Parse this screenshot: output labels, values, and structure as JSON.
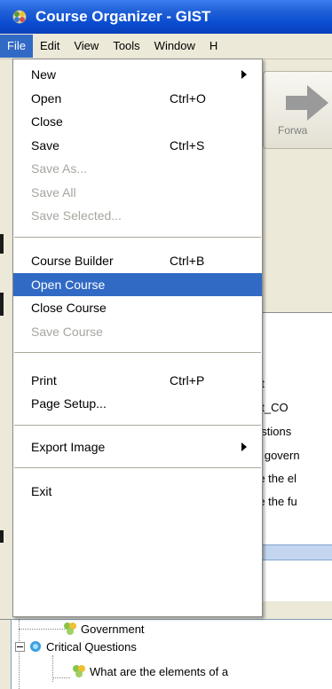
{
  "window": {
    "title": "Course Organizer - GIST",
    "icon": "app-gear-icon"
  },
  "menubar": [
    "File",
    "Edit",
    "View",
    "Tools",
    "Window",
    "H"
  ],
  "file_menu": {
    "new": "New",
    "open": "Open",
    "open_sc": "Ctrl+O",
    "close": "Close",
    "save": "Save",
    "save_sc": "Ctrl+S",
    "save_as": "Save As...",
    "save_all": "Save All",
    "save_selected": "Save Selected...",
    "course_builder": "Course Builder",
    "course_builder_sc": "Ctrl+B",
    "open_course": "Open Course",
    "close_course": "Close Course",
    "save_course": "Save Course",
    "print": "Print",
    "print_sc": "Ctrl+P",
    "page_setup": "Page Setup...",
    "export_image": "Export Image",
    "exit": "Exit"
  },
  "toolbar": {
    "forward_label": "Forwa"
  },
  "content_lines": [
    "nt",
    "nt_CO",
    "estions",
    "e govern",
    "re the el",
    "re the fu"
  ],
  "tree": {
    "government": "Government",
    "critical_questions": "Critical Questions",
    "what_are": "What are the elements of a"
  },
  "colors": {
    "titlebar": "#0a4cd0",
    "menu_highlight": "#316ac5",
    "disabled_text": "#a7a6a0"
  }
}
